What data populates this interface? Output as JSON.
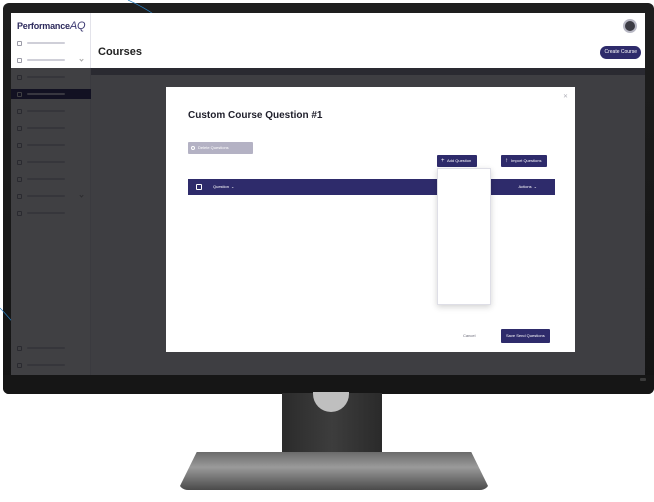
{
  "app": {
    "logo_text": "Performance",
    "logo_mark": "AQ",
    "page_title": "Courses",
    "header_button": "Create Course"
  },
  "sidebar": {
    "items": [
      {
        "label": "",
        "icon": "home-icon",
        "active": false,
        "chevron": false
      },
      {
        "label": "",
        "icon": "users-icon",
        "active": false,
        "chevron": true
      },
      {
        "label": "",
        "icon": "chart-icon",
        "active": false,
        "chevron": false
      },
      {
        "label": "",
        "icon": "book-icon",
        "active": true,
        "chevron": false
      },
      {
        "label": "",
        "icon": "document-icon",
        "active": false,
        "chevron": false
      },
      {
        "label": "",
        "icon": "calendar-icon",
        "active": false,
        "chevron": false
      },
      {
        "label": "",
        "icon": "pin-icon",
        "active": false,
        "chevron": false
      },
      {
        "label": "",
        "icon": "user-icon",
        "active": false,
        "chevron": false
      },
      {
        "label": "",
        "icon": "gear-icon",
        "active": false,
        "chevron": false
      },
      {
        "label": "",
        "icon": "grid-icon",
        "active": false,
        "chevron": true
      },
      {
        "label": "",
        "icon": "list-icon",
        "active": false,
        "chevron": false
      }
    ],
    "bottom_items": [
      {
        "label": "",
        "icon": "help-icon"
      },
      {
        "label": "",
        "icon": "logout-icon"
      }
    ]
  },
  "modal": {
    "title": "Custom Course Question #1",
    "delete_button": "Delete Questions",
    "add_button": "Add Question",
    "import_button": "Import Questions",
    "table": {
      "col_question": "Question",
      "col_actions": "Actions"
    },
    "empty_text": "",
    "dropdown_items": [
      "",
      "",
      "",
      "",
      "",
      "",
      "",
      "",
      ""
    ],
    "cancel_label": "Cancel",
    "save_label": "Save Send Questions"
  },
  "colors": {
    "brand": "#2e2b6b",
    "disabled": "#b4b2c4",
    "overlay": "#0a0a0e"
  }
}
